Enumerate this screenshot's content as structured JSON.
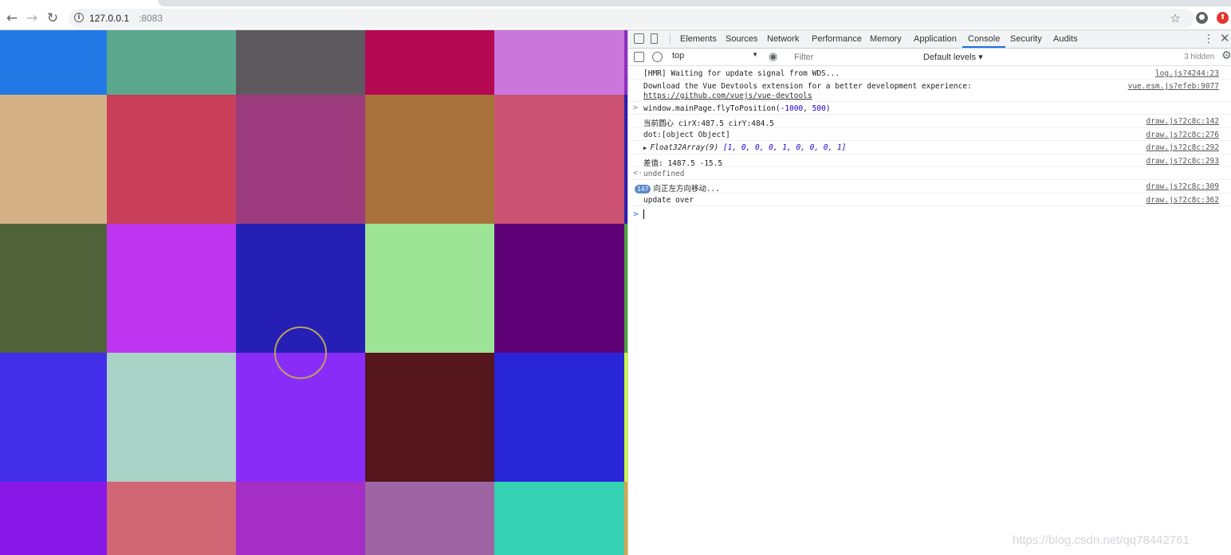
{
  "browser": {
    "url_host": "127.0.0.1",
    "url_port": ":8083",
    "back_icon": "arrow-left-icon",
    "forward_icon": "arrow-right-icon",
    "reload_icon": "reload-icon",
    "bookmark_icon": "star-icon"
  },
  "canvas": {
    "cells": [
      [
        "#2279e5",
        "#5ba88e",
        "#5e595e",
        "#b50853",
        "#c977db"
      ],
      [
        "#d4b186",
        "#c93e58",
        "#9c3b7d",
        "#a9713c",
        "#cc5273"
      ],
      [
        "#4f6239",
        "#bd35ef",
        "#251fb5",
        "#9de497",
        "#5e0076"
      ],
      [
        "#422ee8",
        "#a9d3c6",
        "#8a2cf8",
        "#56161e",
        "#2826d6"
      ],
      [
        "#8818e8",
        "#d06574",
        "#a52ec6",
        "#9d65a3",
        "#34d1b3"
      ]
    ],
    "edge_strip": [
      "#8e2dc4",
      "#2d1fb0",
      "#4da33d",
      "#c9ff3a",
      "#d8a44b"
    ],
    "circle_color": "#b7a15e"
  },
  "devtools": {
    "tabs": [
      "Elements",
      "Sources",
      "Network",
      "Performance",
      "Memory",
      "Application",
      "Console",
      "Security",
      "Audits"
    ],
    "active_tab": "Console",
    "context": "top",
    "filter_placeholder": "Filter",
    "levels": "Default levels ▾",
    "hidden": "3 hidden",
    "accent": "#1a73e8"
  },
  "console": {
    "messages": [
      {
        "text": "[HMR] Waiting for update signal from WDS...",
        "source": "log.js?4244:23"
      },
      {
        "text": "Download the Vue Devtools extension for a better development experience:",
        "link": "https://github.com/vuejs/vue-devtools",
        "source": "vue.esm.js?efeb:9077"
      },
      {
        "prefix": ">",
        "text_pre": "window.mainPage.flyToPosition(",
        "num1": "-1000",
        "sep": ", ",
        "num2": "500",
        "text_post": ")"
      },
      {
        "text": "当前圆心 cirX:487.5  cirY:484.5",
        "source": "draw.js?2c8c:142"
      },
      {
        "text": "dot:[object Object]",
        "source": "draw.js?2c8c:276"
      },
      {
        "text_pre": "▶ ",
        "italic": "Float32Array(9) ",
        "array": "[1, 0, 0, 0, 1, 0, 0, 0, 1]",
        "source": "draw.js?2c8c:292"
      },
      {
        "text": "差值: 1487.5  -15.5",
        "source": "draw.js?2c8c:293"
      },
      {
        "prefix": "<·",
        "text": "undefined"
      },
      {
        "badge": "147",
        "text": "向正左方向移动...",
        "source": "draw.js?2c8c:309"
      },
      {
        "text": "update over",
        "source": "draw.js?2c8c:362"
      }
    ],
    "prompt": ">"
  },
  "watermark": "https://blog.csdn.net/qq78442761"
}
